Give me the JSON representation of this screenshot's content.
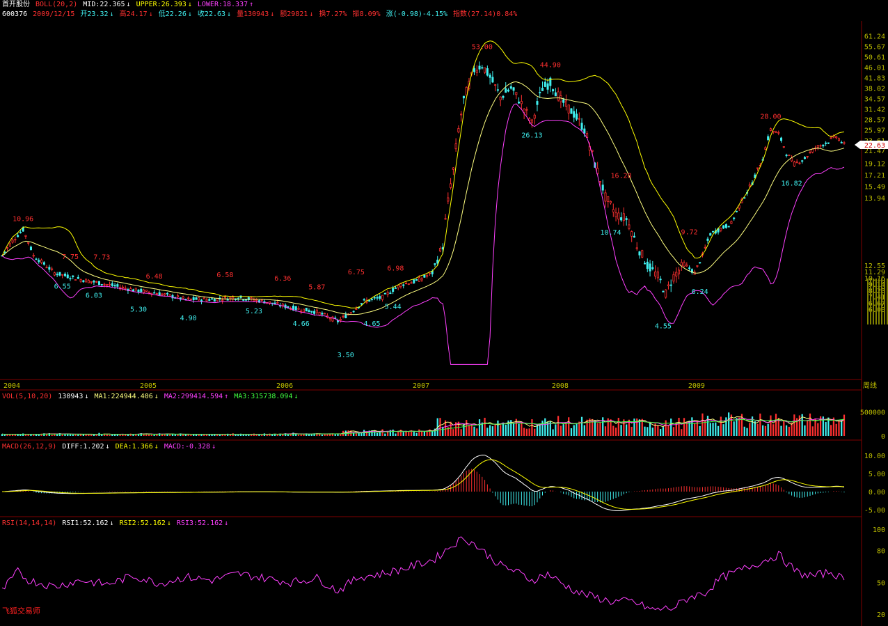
{
  "header": {
    "stock_name": "首开股份",
    "boll_label": "BOLL(20,2)",
    "mid": "MID:22.365",
    "upper": "UPPER:26.393",
    "lower": "LOWER:18.337",
    "code": "600376",
    "date": "2009/12/15",
    "open": "开23.32",
    "high": "高24.17",
    "low": "低22.26",
    "close": "收22.63",
    "volume": "量130943",
    "amount": "额29821",
    "turnover": "换7.27%",
    "amplitude": "振8.09%",
    "change": "涨(-0.98)-4.15%",
    "index": "指数(27.14)0.84%"
  },
  "colors": {
    "up": "#ff3030",
    "down": "#40f0f0",
    "mid": "#ffff80",
    "upper": "#ffff00",
    "lower": "#ff40ff",
    "axis": "#800000",
    "text_axis": "#c0c000"
  },
  "price_axis": {
    "ticks": [
      "61.24",
      "55.67",
      "50.61",
      "46.01",
      "41.83",
      "38.02",
      "34.57",
      "31.42",
      "28.57",
      "25.97",
      "23.61",
      "21.47",
      "19.12",
      "17.21",
      "15.49",
      "13.94",
      "12.55",
      "11.29",
      "10.16",
      "9.14",
      "8.23",
      "7.41",
      "6.67",
      "6.00"
    ],
    "current_price_tag": "22.63"
  },
  "year_labels": [
    "2004",
    "2005",
    "2006",
    "2007",
    "2008",
    "2009"
  ],
  "period_label": "周线",
  "vol_header": {
    "label": "VOL(5,10,20)",
    "value": "130943",
    "ma1": "MA1:224944.406",
    "ma2": "MA2:299414.594",
    "ma3": "MA3:315738.094"
  },
  "vol_axis": [
    "500000",
    "0"
  ],
  "macd_header": {
    "label": "MACD(26,12,9)",
    "diff": "DIFF:1.202",
    "dea": "DEA:1.366",
    "macd": "MACD:-0.328"
  },
  "macd_axis": [
    "10.00",
    "5.00",
    "0.00",
    "-5.00"
  ],
  "rsi_header": {
    "label": "RSI(14,14,14)",
    "rsi1": "RSI1:52.162",
    "rsi2": "RSI2:52.162",
    "rsi3": "RSI3:52.162"
  },
  "rsi_axis": [
    "100",
    "80",
    "50",
    "20"
  ],
  "footer_brand": "飞狐交易师",
  "chart_data": {
    "type": "line",
    "title": "首开股份 600376 周线 BOLL(20,2)",
    "price_labels_high": [
      {
        "week": 8,
        "value": 10.96
      },
      {
        "week": 26,
        "value": 7.75
      },
      {
        "week": 38,
        "value": 7.73
      },
      {
        "week": 58,
        "value": 6.48
      },
      {
        "week": 85,
        "value": 6.58
      },
      {
        "week": 107,
        "value": 6.36
      },
      {
        "week": 120,
        "value": 5.87
      },
      {
        "week": 135,
        "value": 6.75
      },
      {
        "week": 150,
        "value": 6.98
      },
      {
        "week": 183,
        "value": 53.0
      },
      {
        "week": 209,
        "value": 44.9
      },
      {
        "week": 236,
        "value": 16.28
      },
      {
        "week": 262,
        "value": 9.72
      },
      {
        "week": 293,
        "value": 28.0
      }
    ],
    "price_labels_low": [
      {
        "week": 23,
        "value": 6.55
      },
      {
        "week": 35,
        "value": 6.03
      },
      {
        "week": 52,
        "value": 5.3
      },
      {
        "week": 71,
        "value": 4.9
      },
      {
        "week": 96,
        "value": 5.23
      },
      {
        "week": 114,
        "value": 4.66
      },
      {
        "week": 131,
        "value": 3.5
      },
      {
        "week": 141,
        "value": 4.65
      },
      {
        "week": 149,
        "value": 5.44
      },
      {
        "week": 202,
        "value": 26.13
      },
      {
        "week": 232,
        "value": 10.74
      },
      {
        "week": 252,
        "value": 4.55
      },
      {
        "week": 266,
        "value": 6.24
      },
      {
        "week": 301,
        "value": 16.82
      }
    ],
    "anchors_close": [
      [
        0,
        8.2
      ],
      [
        4,
        9.4
      ],
      [
        8,
        10.4
      ],
      [
        12,
        8.2
      ],
      [
        20,
        7.0
      ],
      [
        30,
        6.6
      ],
      [
        40,
        6.3
      ],
      [
        50,
        6.0
      ],
      [
        60,
        5.8
      ],
      [
        70,
        5.5
      ],
      [
        80,
        5.5
      ],
      [
        90,
        5.6
      ],
      [
        100,
        5.4
      ],
      [
        110,
        5.1
      ],
      [
        120,
        4.9
      ],
      [
        128,
        4.5
      ],
      [
        132,
        4.8
      ],
      [
        138,
        5.4
      ],
      [
        145,
        5.6
      ],
      [
        152,
        6.3
      ],
      [
        158,
        6.5
      ],
      [
        164,
        7.0
      ],
      [
        168,
        9.0
      ],
      [
        172,
        18.0
      ],
      [
        176,
        34.0
      ],
      [
        180,
        45.0
      ],
      [
        183,
        47.0
      ],
      [
        186,
        42.0
      ],
      [
        190,
        35.0
      ],
      [
        194,
        38.0
      ],
      [
        198,
        33.0
      ],
      [
        202,
        27.5
      ],
      [
        206,
        38.0
      ],
      [
        209,
        40.0
      ],
      [
        213,
        34.0
      ],
      [
        218,
        30.0
      ],
      [
        222,
        26.0
      ],
      [
        226,
        19.0
      ],
      [
        230,
        14.0
      ],
      [
        234,
        12.0
      ],
      [
        238,
        11.5
      ],
      [
        242,
        9.0
      ],
      [
        246,
        7.5
      ],
      [
        250,
        6.8
      ],
      [
        253,
        5.8
      ],
      [
        256,
        6.8
      ],
      [
        260,
        7.6
      ],
      [
        264,
        7.0
      ],
      [
        267,
        8.2
      ],
      [
        270,
        10.0
      ],
      [
        274,
        10.5
      ],
      [
        278,
        11.0
      ],
      [
        282,
        13.5
      ],
      [
        286,
        16.0
      ],
      [
        290,
        20.0
      ],
      [
        293,
        26.0
      ],
      [
        296,
        25.0
      ],
      [
        299,
        21.0
      ],
      [
        302,
        19.0
      ],
      [
        306,
        20.0
      ],
      [
        310,
        22.0
      ],
      [
        314,
        23.0
      ],
      [
        318,
        24.5
      ],
      [
        321,
        22.63
      ]
    ],
    "rsi_anchors": [
      [
        0,
        42
      ],
      [
        6,
        60
      ],
      [
        10,
        52
      ],
      [
        20,
        46
      ],
      [
        30,
        52
      ],
      [
        40,
        48
      ],
      [
        50,
        56
      ],
      [
        60,
        49
      ],
      [
        70,
        55
      ],
      [
        80,
        52
      ],
      [
        90,
        58
      ],
      [
        100,
        54
      ],
      [
        110,
        50
      ],
      [
        120,
        54
      ],
      [
        128,
        42
      ],
      [
        136,
        55
      ],
      [
        145,
        58
      ],
      [
        155,
        64
      ],
      [
        165,
        72
      ],
      [
        172,
        86
      ],
      [
        176,
        92
      ],
      [
        180,
        86
      ],
      [
        184,
        78
      ],
      [
        190,
        66
      ],
      [
        196,
        60
      ],
      [
        202,
        52
      ],
      [
        208,
        58
      ],
      [
        214,
        48
      ],
      [
        220,
        40
      ],
      [
        226,
        36
      ],
      [
        232,
        32
      ],
      [
        240,
        32
      ],
      [
        248,
        24
      ],
      [
        256,
        26
      ],
      [
        262,
        36
      ],
      [
        268,
        40
      ],
      [
        274,
        54
      ],
      [
        280,
        60
      ],
      [
        286,
        66
      ],
      [
        292,
        72
      ],
      [
        296,
        76
      ],
      [
        300,
        66
      ],
      [
        304,
        58
      ],
      [
        310,
        56
      ],
      [
        316,
        60
      ],
      [
        321,
        52
      ]
    ],
    "weeks": 322,
    "y_scale": "log",
    "ylim": [
      3.0,
      66.0
    ]
  }
}
